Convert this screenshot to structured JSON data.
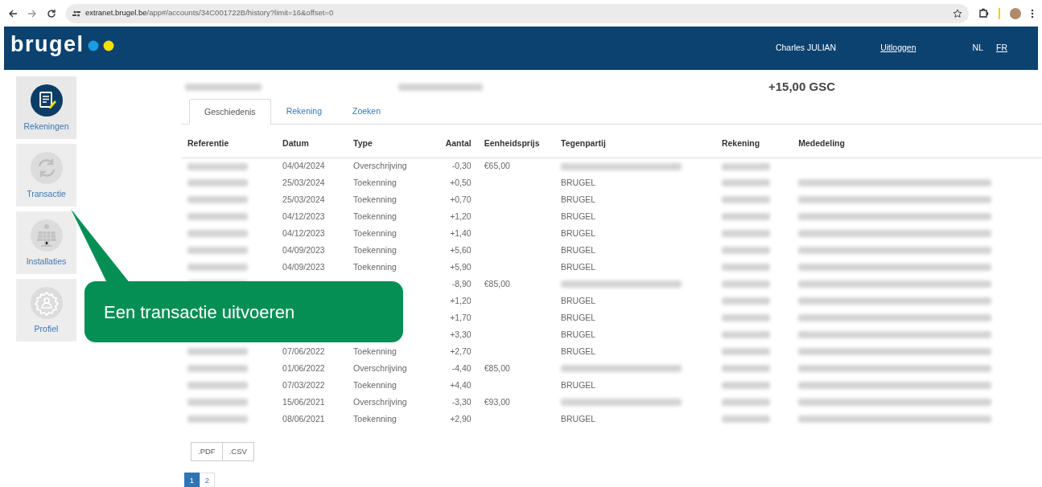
{
  "browser": {
    "url_host": "extranet.brugel.be",
    "url_path": "/app#/accounts/34C001722B/history?limit=16&offset=0"
  },
  "header": {
    "logo": "brugel",
    "user": "Charles JULIAN",
    "logout": "Uitloggen",
    "languages": [
      {
        "label": "NL",
        "selected": true
      },
      {
        "label": "FR",
        "selected": false
      }
    ]
  },
  "sidebar": {
    "items": [
      {
        "kind": "accounts",
        "label": "Rekeningen",
        "selected": true
      },
      {
        "kind": "transaction",
        "label": "Transactie",
        "selected": false
      },
      {
        "kind": "installations",
        "label": "Installaties",
        "selected": false
      },
      {
        "kind": "profile",
        "label": "Profiel",
        "selected": false
      }
    ]
  },
  "account": {
    "balance": "+15,00 GSC"
  },
  "tabs": [
    {
      "label": "Geschiedenis",
      "selected": true
    },
    {
      "label": "Rekening",
      "selected": false
    },
    {
      "label": "Zoeken",
      "selected": false
    }
  ],
  "table": {
    "columns": [
      "Referentie",
      "Datum",
      "Type",
      "Aantal",
      "Eenheidsprijs",
      "Tegenpartij",
      "Rekening",
      "Mededeling"
    ],
    "rows": [
      {
        "date": "04/04/2024",
        "type": "Overschrijving",
        "amount": "-0,30",
        "price": "€65,00",
        "counterparty_redacted": true,
        "message_redacted": false
      },
      {
        "date": "25/03/2024",
        "type": "Toekenning",
        "amount": "+0,50",
        "counterparty": "BRUGEL",
        "counterparty_redacted": false,
        "message_redacted": true
      },
      {
        "date": "25/03/2024",
        "type": "Toekenning",
        "amount": "+0,70",
        "counterparty": "BRUGEL",
        "counterparty_redacted": false,
        "message_redacted": true
      },
      {
        "date": "04/12/2023",
        "type": "Toekenning",
        "amount": "+1,20",
        "counterparty": "BRUGEL",
        "counterparty_redacted": false,
        "message_redacted": true
      },
      {
        "date": "04/12/2023",
        "type": "Toekenning",
        "amount": "+1,40",
        "counterparty": "BRUGEL",
        "counterparty_redacted": false,
        "message_redacted": true
      },
      {
        "date": "04/09/2023",
        "type": "Toekenning",
        "amount": "+5,60",
        "counterparty": "BRUGEL",
        "counterparty_redacted": false,
        "message_redacted": true
      },
      {
        "date": "04/09/2023",
        "type": "Toekenning",
        "amount": "+5,90",
        "counterparty": "BRUGEL",
        "counterparty_redacted": false,
        "message_redacted": true
      },
      {
        "amount": "-8,90",
        "price": "€85,00",
        "counterparty_redacted": true,
        "message_redacted": true
      },
      {
        "covered": true,
        "amount": "+1,20",
        "counterparty": "BRUGEL",
        "counterparty_redacted": false,
        "message_redacted": true
      },
      {
        "covered": true,
        "amount": "+1,70",
        "counterparty": "BRUGEL",
        "counterparty_redacted": false,
        "message_redacted": true
      },
      {
        "covered": true,
        "amount": "+3,30",
        "counterparty": "BRUGEL",
        "counterparty_redacted": false,
        "message_redacted": true
      },
      {
        "date": "07/06/2022",
        "type": "Toekenning",
        "amount": "+2,70",
        "counterparty": "BRUGEL",
        "counterparty_redacted": false,
        "message_redacted": true
      },
      {
        "date": "01/06/2022",
        "type": "Overschrijving",
        "amount": "-4,40",
        "price": "€85,00",
        "counterparty_redacted": true,
        "message_redacted": true
      },
      {
        "date": "07/03/2022",
        "type": "Toekenning",
        "amount": "+4,40",
        "counterparty": "BRUGEL",
        "counterparty_redacted": false,
        "message_redacted": true
      },
      {
        "date": "15/06/2021",
        "type": "Overschrijving",
        "amount": "-3,30",
        "price": "€93,00",
        "counterparty_redacted": true,
        "message_redacted": true
      },
      {
        "date": "08/06/2021",
        "type": "Toekenning",
        "amount": "+2,90",
        "counterparty": "BRUGEL",
        "counterparty_redacted": false,
        "message_redacted": true
      }
    ]
  },
  "exports": [
    ".PDF",
    ".CSV"
  ],
  "pagination": [
    {
      "label": "1",
      "selected": true
    },
    {
      "label": "2",
      "selected": false
    }
  ],
  "callout": {
    "text": "Een transactie uitvoeren"
  }
}
